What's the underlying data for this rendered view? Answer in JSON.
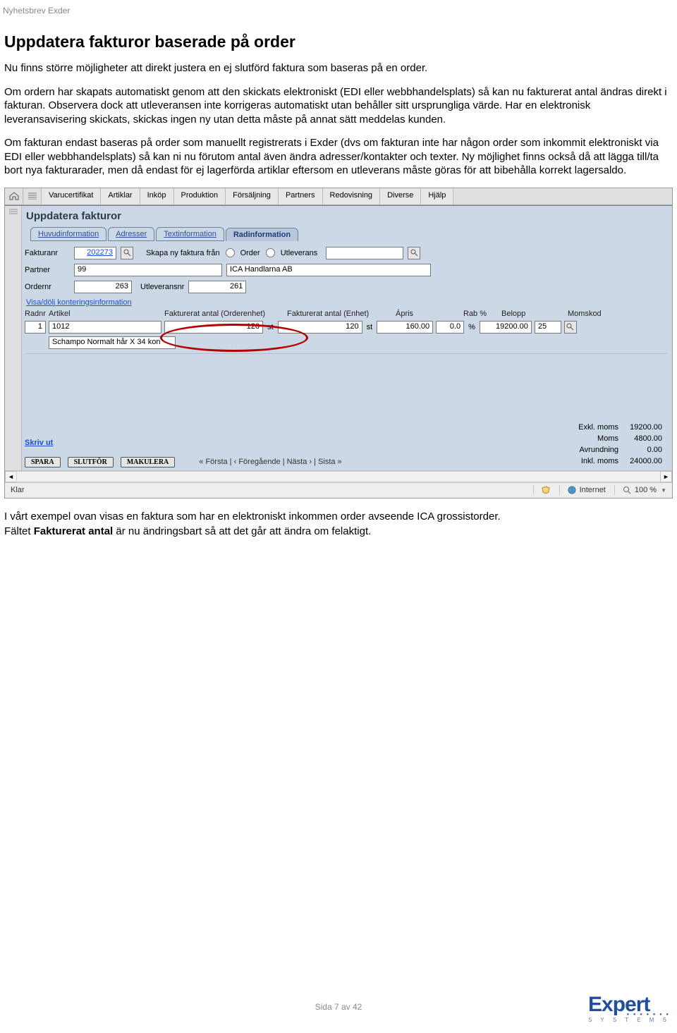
{
  "header": "Nyhetsbrev Exder",
  "section_title": "Uppdatera fakturor baserade på order",
  "paragraphs": {
    "p1": "Nu finns större möjligheter att direkt justera en ej slutförd faktura som baseras på en order.",
    "p2": "Om ordern har skapats automatiskt genom att den skickats elektroniskt (EDI eller webbhandelsplats) så kan nu fakturerat antal ändras direkt i fakturan. Observera dock att utleveransen inte korrigeras automatiskt utan behåller sitt ursprungliga värde. Har en elektronisk leveransavisering skickats, skickas ingen ny utan detta måste på annat sätt meddelas kunden.",
    "p3": "Om fakturan endast baseras på order som manuellt registrerats i Exder (dvs om fakturan inte har någon order som inkommit elektroniskt via EDI eller webbhandelsplats) så kan ni nu förutom antal även ändra adresser/kontakter och texter. Ny möjlighet finns också då att lägga till/ta bort nya fakturarader, men då endast för ej lagerförda artiklar eftersom en utleverans måste göras för att bibehålla korrekt lagersaldo."
  },
  "menus": [
    "Varucertifikat",
    "Artiklar",
    "Inköp",
    "Produktion",
    "Försäljning",
    "Partners",
    "Redovisning",
    "Diverse",
    "Hjälp"
  ],
  "app": {
    "title": "Uppdatera fakturor",
    "tabs": [
      "Huvudinformation",
      "Adresser",
      "Textinformation",
      "Radinformation"
    ],
    "active_tab_index": 3,
    "labels": {
      "fakturanr": "Fakturanr",
      "partner": "Partner",
      "ordernr": "Ordernr",
      "utleveransnr": "Utleveransnr",
      "skapa": "Skapa ny faktura från",
      "order": "Order",
      "utleverans": "Utleverans",
      "konteringslink": "Visa/dölj konteringsinformation",
      "skrivut": "Skriv ut",
      "pager": "« Första  |  ‹ Föregående  |  Nästa ›  |  Sista »"
    },
    "values": {
      "fakturanr": "202273",
      "partner_code": "99",
      "partner_name": "ICA Handlarna AB",
      "ordernr": "263",
      "utleveransnr": "261"
    },
    "grid": {
      "headers": {
        "radnr": "Radnr",
        "artikel": "Artikel",
        "fakt_orderenhet": "Fakturerat antal (Orderenhet)",
        "fakt_enhet": "Fakturerat antal (Enhet)",
        "apris": "Ápris",
        "rab": "Rab %",
        "belopp": "Belopp",
        "momskod": "Momskod"
      },
      "row": {
        "radnr": "1",
        "artikel": "1012",
        "fakt_orderenhet": "120",
        "unit1": "st",
        "fakt_enhet": "120",
        "unit2": "st",
        "apris": "160.00",
        "rab": "0.0",
        "pct": "%",
        "belopp": "19200.00",
        "momskod": "25",
        "artikel_desc": "Schampo Normalt hår X 34 kon"
      }
    },
    "actions": [
      "SPARA",
      "SLUTFÖR",
      "MAKULERA"
    ],
    "totals": {
      "exkl_lbl": "Exkl. moms",
      "exkl_val": "19200.00",
      "moms_lbl": "Moms",
      "moms_val": "4800.00",
      "avr_lbl": "Avrundning",
      "avr_val": "0.00",
      "inkl_lbl": "Inkl. moms",
      "inkl_val": "24000.00"
    },
    "statusbar": {
      "left": "Klar",
      "internet": "Internet",
      "zoom": "100 %"
    }
  },
  "after_text": {
    "line1": "I vårt exempel ovan visas en faktura som har en elektroniskt inkommen order avseende ICA grossistorder.",
    "line2_a": "Fältet ",
    "line2_b": "Fakturerat antal",
    "line2_c": " är nu ändringsbart så att det går att ändra om felaktigt."
  },
  "page_number": "Sida 7 av 42",
  "logo": {
    "name": "Expert",
    "sub": "S Y S T E M S"
  }
}
